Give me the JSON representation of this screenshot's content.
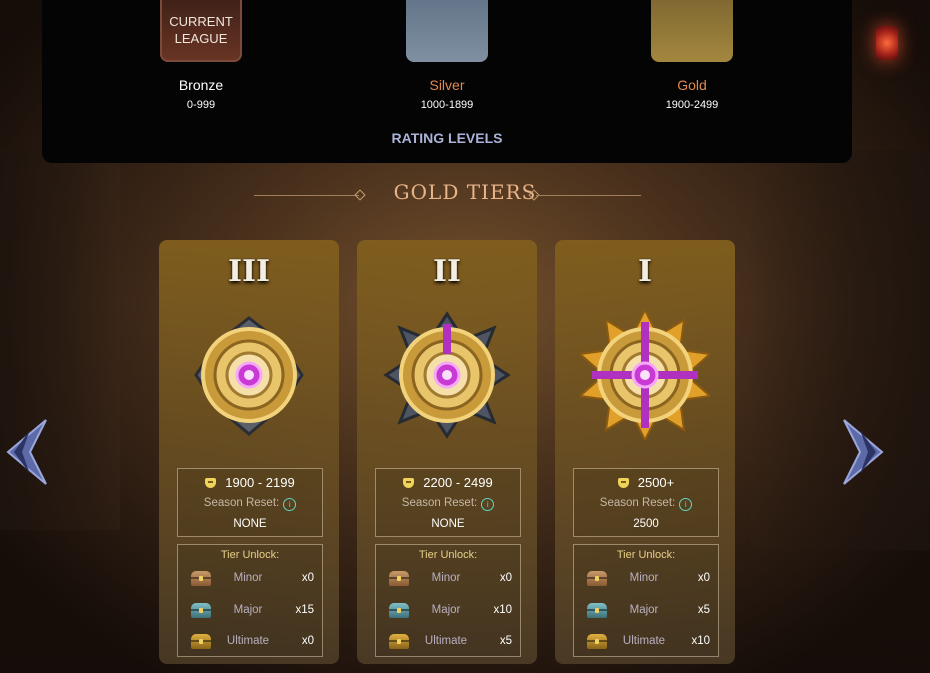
{
  "rating_panel": {
    "current_league_label": "CURRENT LEAGUE",
    "leagues": [
      {
        "name": "Bronze",
        "range": "0-999",
        "name_color": "#ffffff"
      },
      {
        "name": "Silver",
        "range": "1000-1899",
        "name_color": "#e0894e"
      },
      {
        "name": "Gold",
        "range": "1900-2499",
        "name_color": "#e0894e"
      }
    ],
    "footer": "RATING LEVELS"
  },
  "tiers_title": "GOLD TIERS",
  "labels": {
    "season_reset": "Season Reset:",
    "tier_unlock": "Tier Unlock:",
    "info": "i"
  },
  "tiers": [
    {
      "roman": "III",
      "range": "1900 - 2199",
      "season_reset": "NONE",
      "chests": [
        {
          "name": "Minor",
          "qty": "x0"
        },
        {
          "name": "Major",
          "qty": "x15"
        },
        {
          "name": "Ultimate",
          "qty": "x0"
        }
      ]
    },
    {
      "roman": "II",
      "range": "2200 - 2499",
      "season_reset": "NONE",
      "chests": [
        {
          "name": "Minor",
          "qty": "x0"
        },
        {
          "name": "Major",
          "qty": "x10"
        },
        {
          "name": "Ultimate",
          "qty": "x5"
        }
      ]
    },
    {
      "roman": "I",
      "range": "2500+",
      "season_reset": "2500",
      "chests": [
        {
          "name": "Minor",
          "qty": "x0"
        },
        {
          "name": "Major",
          "qty": "x5"
        },
        {
          "name": "Ultimate",
          "qty": "x10"
        }
      ]
    }
  ],
  "icons": {
    "nav_prev": "chevron-left-icon",
    "nav_next": "chevron-right-icon",
    "rank_shield": "shield-icon",
    "info": "info-icon"
  },
  "colors": {
    "accent_title": "#e8b48a",
    "rating_levels": "#aab3d8",
    "card_gold": "#805e1e",
    "info_teal": "#5fd4c4"
  }
}
